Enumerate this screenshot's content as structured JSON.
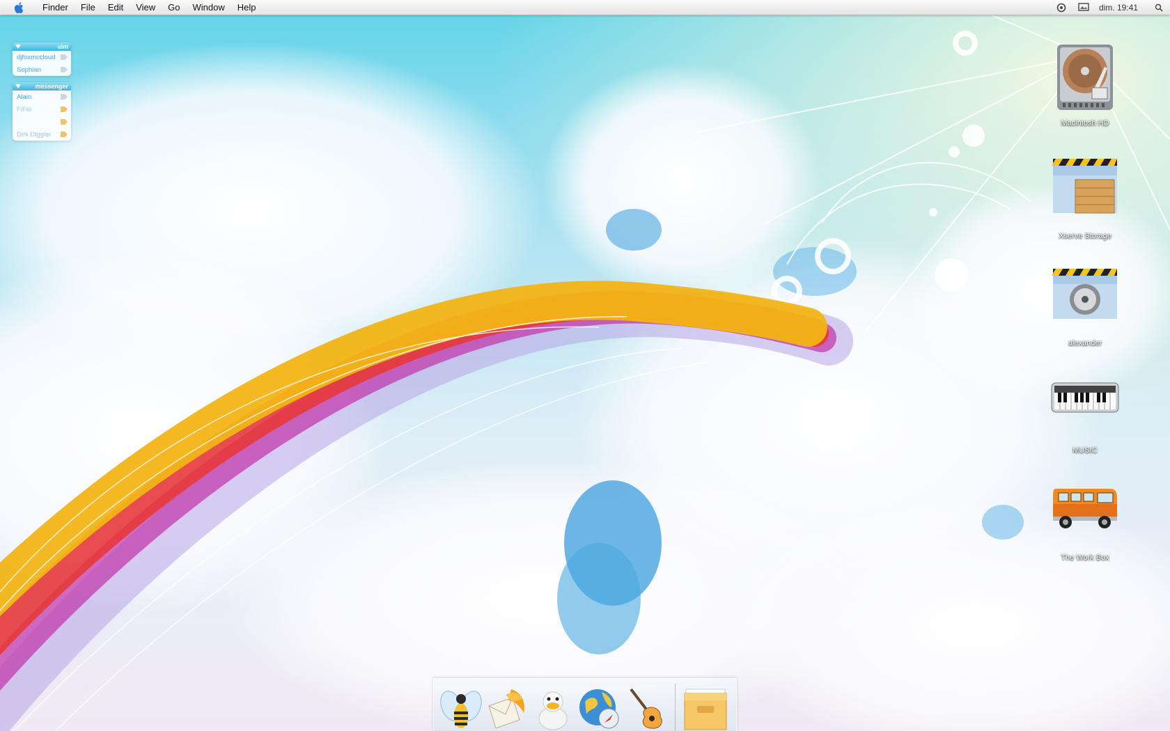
{
  "menubar": {
    "apple_icon": "apple-icon",
    "menus": [
      "Finder",
      "File",
      "Edit",
      "View",
      "Go",
      "Window",
      "Help"
    ],
    "clock": "dim. 19:41",
    "status_icons": [
      "sync-icon",
      "display-icon",
      "spotlight-icon"
    ]
  },
  "buddy_lists": [
    {
      "title": "aim",
      "buddies": [
        "djfoxmccloud",
        "Sophian"
      ]
    },
    {
      "title": "messenger",
      "buddies": [
        "Alain",
        "FiFlo",
        "",
        "Dirk Diggler"
      ]
    }
  ],
  "desktop_icons": [
    {
      "label": "Macintosh HD",
      "icon": "hard-drive-icon"
    },
    {
      "label": "Xserve Storage",
      "icon": "storage-folder-icon"
    },
    {
      "label": "alexander",
      "icon": "safe-folder-icon"
    },
    {
      "label": "MUSIC",
      "icon": "keyboard-icon"
    },
    {
      "label": "The Work Box",
      "icon": "van-icon"
    }
  ],
  "dock": {
    "apps": [
      "bee-app-icon",
      "mail-bird-icon",
      "duck-app-icon",
      "globe-safari-icon",
      "guitar-icon"
    ],
    "stack": "box-folder-icon"
  },
  "colors": {
    "rainbow_yellow": "#f2b416",
    "rainbow_red": "#e5383b",
    "rainbow_magenta": "#c23cae",
    "rainbow_purple": "#b28fd9",
    "sky_blue": "#3aa6e0",
    "buddy_header": "#39b8e3"
  }
}
